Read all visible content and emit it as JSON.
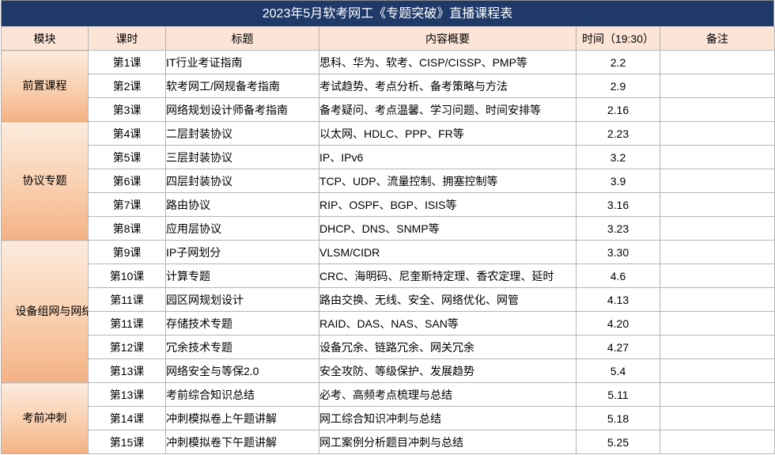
{
  "title": "2023年5月软考网工《专题突破》直播课程表",
  "header": {
    "module": "模块",
    "lesson": "课时",
    "topic": "标题",
    "summary": "内容概要",
    "time": "时间（19:30）",
    "note": "备注"
  },
  "colors": {
    "title_bar": "#1F3A68",
    "header_bg": "#FCE4D6",
    "module_top": "#FDEBDD",
    "module_bottom": "#F4B183"
  },
  "modules": [
    {
      "name": "前置课程",
      "lessons": [
        {
          "lesson": "第1课",
          "topic": "IT行业考证指南",
          "summary": "思科、华为、软考、CISP/CISSP、PMP等",
          "time": "2.2"
        },
        {
          "lesson": "第2课",
          "topic": "软考网工/网规备考指南",
          "summary": "考试趋势、考点分析、备考策略与方法",
          "time": "2.9"
        },
        {
          "lesson": "第3课",
          "topic": "网络规划设计师备考指南",
          "summary": "备考疑问、考点温馨、学习问题、时间安排等",
          "time": "2.16"
        }
      ]
    },
    {
      "name": "协议专题",
      "lessons": [
        {
          "lesson": "第4课",
          "topic": "二层封装协议",
          "summary": "以太网、HDLC、PPP、FR等",
          "time": "2.23"
        },
        {
          "lesson": "第5课",
          "topic": "三层封装协议",
          "summary": "IP、IPv6",
          "time": "3.2"
        },
        {
          "lesson": "第6课",
          "topic": "四层封装协议",
          "summary": "TCP、UDP、流量控制、拥塞控制等",
          "time": "3.9"
        },
        {
          "lesson": "第7课",
          "topic": "路由协议",
          "summary": "RIP、OSPF、BGP、ISIS等",
          "time": "3.16"
        },
        {
          "lesson": "第8课",
          "topic": "应用层协议",
          "summary": "DHCP、DNS、SNMP等",
          "time": "3.23"
        }
      ]
    },
    {
      "name": "设备组网与网络规划",
      "lessons": [
        {
          "lesson": "第9课",
          "topic": "IP子网划分",
          "summary": "VLSM/CIDR",
          "time": "3.30"
        },
        {
          "lesson": "第10课",
          "topic": "计算专题",
          "summary": "CRC、海明码、尼奎斯特定理、香农定理、延时",
          "time": "4.6"
        },
        {
          "lesson": "第11课",
          "topic": "园区网规划设计",
          "summary": "路由交换、无线、安全、网络优化、网管",
          "time": "4.13"
        },
        {
          "lesson": "第11课",
          "topic": "存储技术专题",
          "summary": "RAID、DAS、NAS、SAN等",
          "time": "4.20"
        },
        {
          "lesson": "第12课",
          "topic": "冗余技术专题",
          "summary": "设备冗余、链路冗余、网关冗余",
          "time": "4.27"
        },
        {
          "lesson": "第13课",
          "topic": "网络安全与等保2.0",
          "summary": "安全攻防、等级保护、发展趋势",
          "time": "5.4"
        }
      ]
    },
    {
      "name": "考前冲刺",
      "lessons": [
        {
          "lesson": "第13课",
          "topic": "考前综合知识总结",
          "summary": "必考、高频考点梳理与总结",
          "time": "5.11"
        },
        {
          "lesson": "第14课",
          "topic": "冲刺模拟卷上午题讲解",
          "summary": "网工综合知识冲刺与总结",
          "time": "5.18"
        },
        {
          "lesson": "第15课",
          "topic": "冲刺模拟卷下午题讲解",
          "summary": "网工案例分析题目冲刺与总结",
          "time": "5.25"
        }
      ]
    }
  ]
}
